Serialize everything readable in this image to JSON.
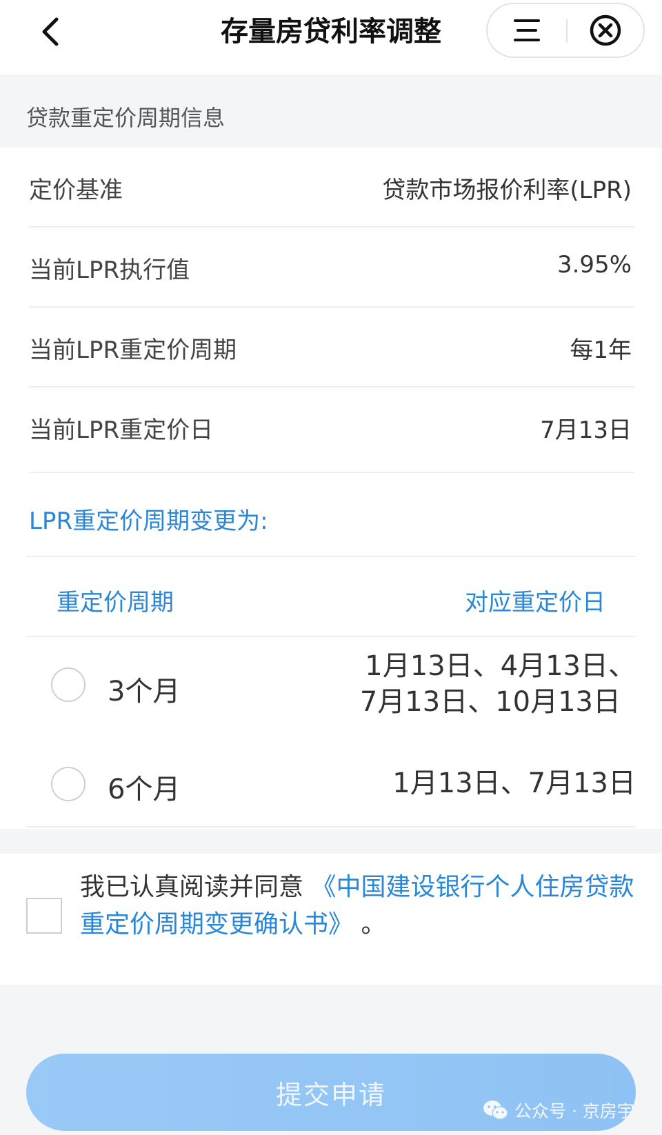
{
  "header": {
    "title": "存量房贷利率调整",
    "back_icon": "chevron-left-icon",
    "menu_icon": "menu-icon",
    "close_icon": "close-circle-icon"
  },
  "section": {
    "title": "贷款重定价周期信息"
  },
  "info_rows": [
    {
      "label": "定价基准",
      "value": "贷款市场报价利率(LPR)"
    },
    {
      "label": "当前LPR执行值",
      "value": "3.95%"
    },
    {
      "label": "当前LPR重定价周期",
      "value": "每1年"
    },
    {
      "label": "当前LPR重定价日",
      "value": "7月13日"
    }
  ],
  "change": {
    "title": "LPR重定价周期变更为:",
    "col_period": "重定价周期",
    "col_date": "对应重定价日",
    "options": [
      {
        "period": "3个月",
        "dates_line1": "1月13日、4月13日、",
        "dates_line2": "7月13日、10月13日"
      },
      {
        "period": "6个月",
        "dates_line1": "1月13日、7月13日",
        "dates_line2": ""
      }
    ]
  },
  "agreement": {
    "prefix": "我已认真阅读并同意",
    "link": "《中国建设银行个人住房贷款重定价周期变更确认书》",
    "suffix": "。"
  },
  "submit_label": "提交申请",
  "watermark": {
    "text": "公众号 · 京房宇",
    "icon": "wechat-icon"
  },
  "colors": {
    "accent": "#2a86d6",
    "button": "#93c5f5"
  }
}
